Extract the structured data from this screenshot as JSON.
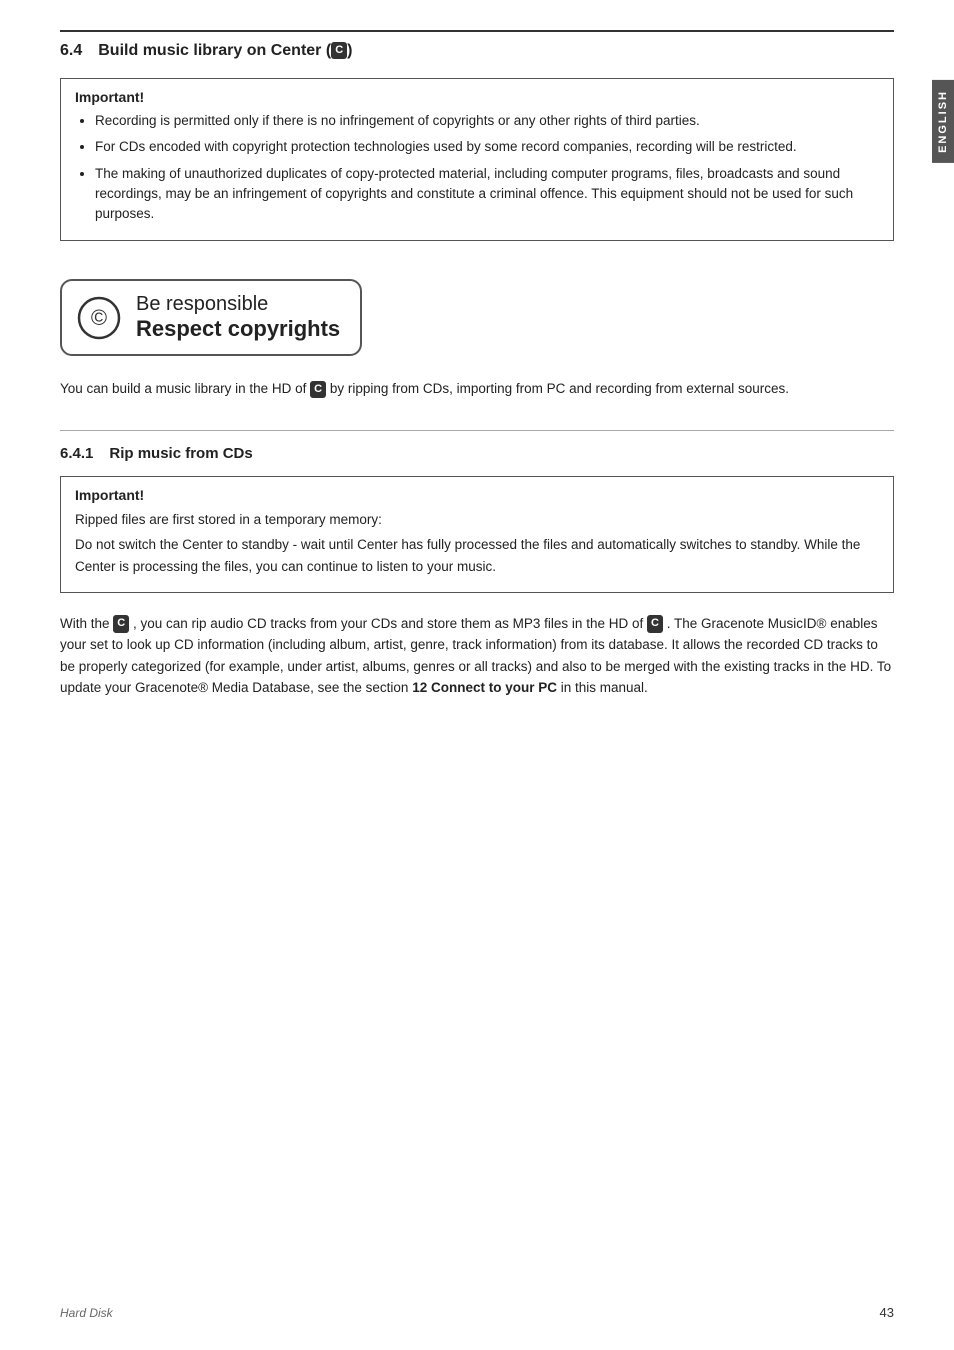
{
  "sidetab": {
    "label": "ENGLISH"
  },
  "section_6_4": {
    "number": "6.4",
    "title": "Build music library on Center (",
    "title_suffix": ")",
    "icon_label": "C",
    "important": {
      "heading": "Important!",
      "bullets": [
        "Recording is permitted only if there is no infringement of copyrights or any other rights of third parties.",
        "For CDs encoded with copyright protection technologies used by some record companies, recording will be restricted.",
        "The making of unauthorized duplicates of copy-protected material, including computer programs, files, broadcasts and sound recordings, may be an infringement of copyrights and constitute a criminal offence. This equipment should not be used for such purposes."
      ]
    },
    "responsible": {
      "line1": "Be responsible",
      "line2": "Respect copyrights"
    },
    "body": "You can build a music library in the HD of",
    "body_suffix": "by ripping from CDs, importing from PC and recording from external sources.",
    "icon_label2": "C"
  },
  "section_6_4_1": {
    "number": "6.4.1",
    "title": "Rip music from CDs",
    "important": {
      "heading": "Important!",
      "para1": "Ripped files are first stored in a temporary memory:",
      "para2": "Do not switch the Center to standby - wait until Center has fully processed the files and automatically switches to standby. While the Center is processing the files, you can continue to listen to your music."
    },
    "body_parts": [
      "With the",
      ", you can rip audio CD tracks from your CDs and store them as MP3 files in the HD of",
      ". The Gracenote MusicID®  enables your set to look up CD information (including album, artist, genre, track information) from its database. It allows the recorded CD tracks to be properly categorized (for example, under artist, albums, genres or all tracks) and also to be merged with the existing tracks in the HD. To update your Gracenote® Media Database, see the section",
      "12 Connect to your PC",
      "in this manual."
    ],
    "icon_label": "C"
  },
  "footer": {
    "label": "Hard Disk",
    "page": "43"
  }
}
